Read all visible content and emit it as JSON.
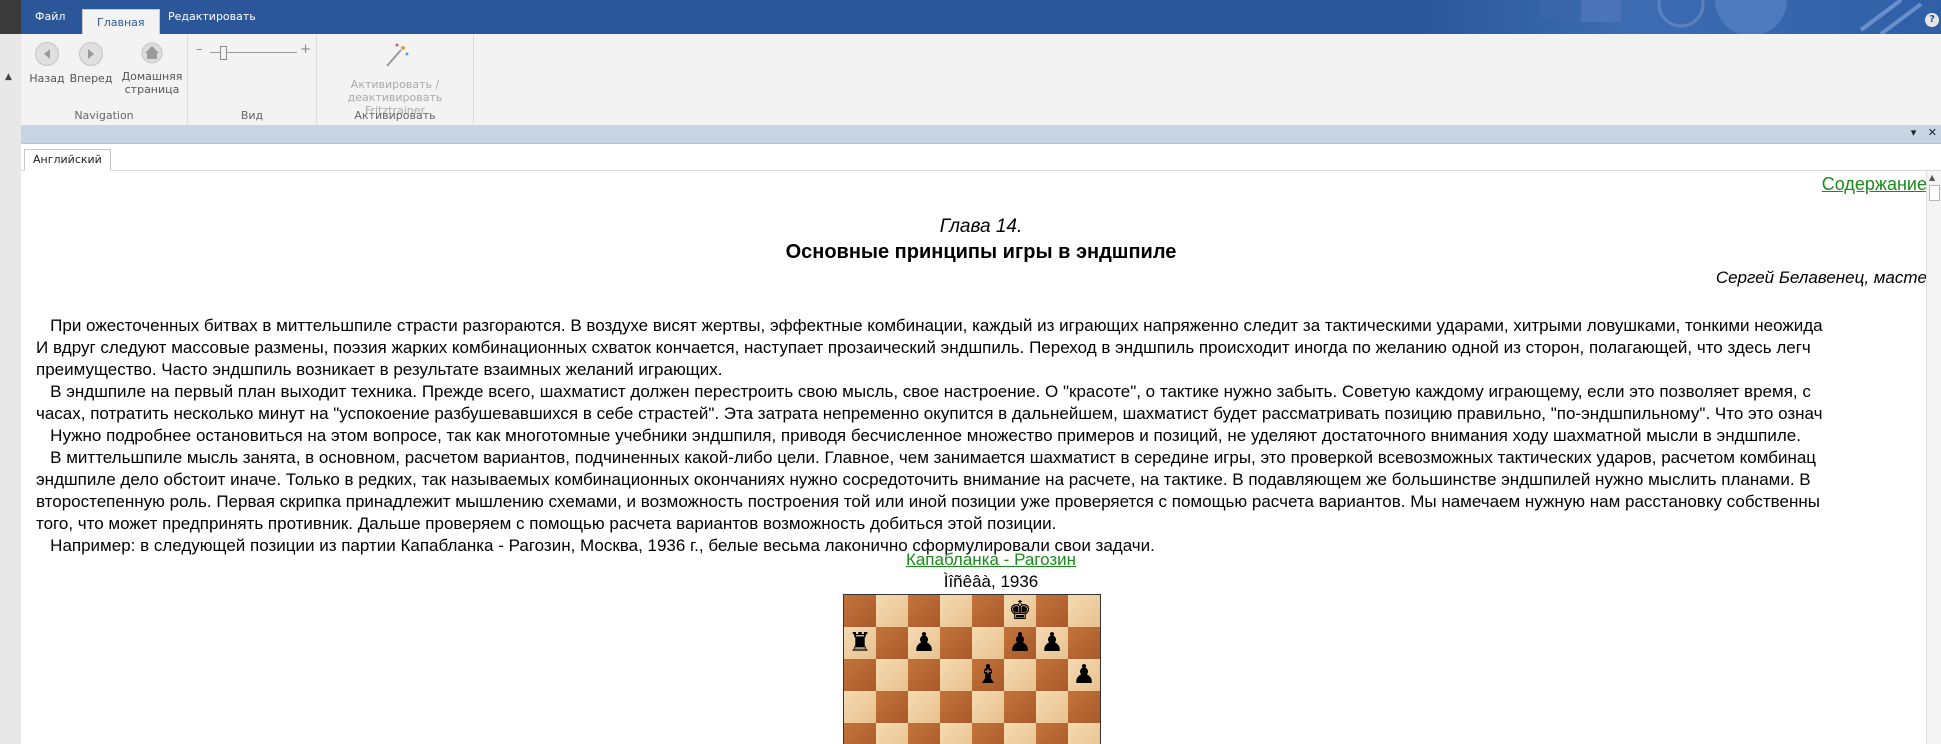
{
  "menu": {
    "file": "Файл",
    "home": "Главная",
    "edit": "Редактировать"
  },
  "help_icon": "?",
  "ribbon": {
    "navigation": {
      "label": "Navigation",
      "back": "Назад",
      "forward": "Вперед",
      "home_line1": "Домашняя",
      "home_line2": "страница"
    },
    "view": {
      "label": "Вид",
      "zoom_minus": "–",
      "zoom_plus": "+",
      "zoom_level_fraction": 0.15
    },
    "activate": {
      "label": "Активировать",
      "button_line1": "Активировать /",
      "button_line2": "деактивировать Fritztrainer"
    }
  },
  "panel": {
    "collapse_icon": "▾",
    "close_icon": "✕"
  },
  "language_tab": "Английский",
  "document": {
    "toc_link": "Содержание",
    "chapter_number": "Глава 14.",
    "chapter_title": "Основные принципы игры в эндшпиле",
    "author": "Сергей Белавенец, масте",
    "paragraphs": [
      "   При ожесточенных битвах в миттельшпиле страсти разгораются. В воздухе висят жертвы, эффектные комбинации, каждый из играющих напряженно следит за тактическими ударами, хитрыми ловушками, тонкими неожида",
      "И вдруг следуют массовые размены, поэзия жарких комбинационных схваток кончается, наступает прозаический эндшпиль. Переход в эндшпиль происходит иногда по желанию одной из сторон, полагающей, что здесь легч",
      "преимущество. Часто эндшпиль возникает в результате взаимных желаний играющих.",
      "   В эндшпиле на первый план выходит техника. Прежде всего, шахматист должен перестроить свою мысль, свое настроение. О \"красоте\", о тактике нужно забыть. Советую каждому играющему, если это позволяет время, с",
      "часах, потратить несколько минут на \"успокоение разбушевавшихся в себе страстей\". Эта затрата непременно окупится в дальнейшем, шахматист будет рассматривать позицию правильно, \"по-эндшпильному\". Что это означ",
      "   Нужно подробнее остановиться на этом вопросе, так как многотомные учебники эндшпиля, приводя бесчисленное множество примеров и позиций, не уделяют достаточного внимания ходу шахматной мысли в эндшпиле.",
      "   В миттельшпиле мысль занята, в основном, расчетом вариантов, подчиненных какой-либо цели. Главное, чем занимается шахматист в середине игры, это проверкой всевозможных тактических ударов, расчетом комбинац",
      "эндшпиле дело обстоит иначе. Только в редких, так называемых комбинационных окончаниях нужно сосредоточить внимание на расчете, на тактике. В подавляющем же большинстве эндшпилей нужно мыслить планами. В",
      "второстепенную роль. Первая скрипка принадлежит мышлению схемами, и возможность построения той или иной позиции уже проверяется с помощью расчета вариантов. Мы намечаем нужную нам расстановку собственны",
      "того, что может предпринять противник. Дальше проверяем с помощью расчета вариантов возможность добиться этой позиции.",
      "   Например: в следующей позиции из партии Капабланка - Рагозин, Москва, 1936 г., белые весьма лаконично сформулировали свои задачи."
    ],
    "game_link": "Капабланка - Рагозин",
    "game_place": "Ìîñêâà, 1936"
  },
  "board": {
    "pieces": [
      {
        "square": "f8",
        "glyph": "♚",
        "name": "black-king"
      },
      {
        "square": "a7",
        "glyph": "♜",
        "name": "black-rook"
      },
      {
        "square": "c7",
        "glyph": "♟",
        "name": "black-pawn-c7"
      },
      {
        "square": "f7",
        "glyph": "♟",
        "name": "black-pawn-f7"
      },
      {
        "square": "g7",
        "glyph": "♟",
        "name": "black-pawn-g7"
      },
      {
        "square": "e6",
        "glyph": "♝",
        "name": "black-bishop"
      },
      {
        "square": "h6",
        "glyph": "♟",
        "name": "black-pawn-h6"
      }
    ]
  }
}
